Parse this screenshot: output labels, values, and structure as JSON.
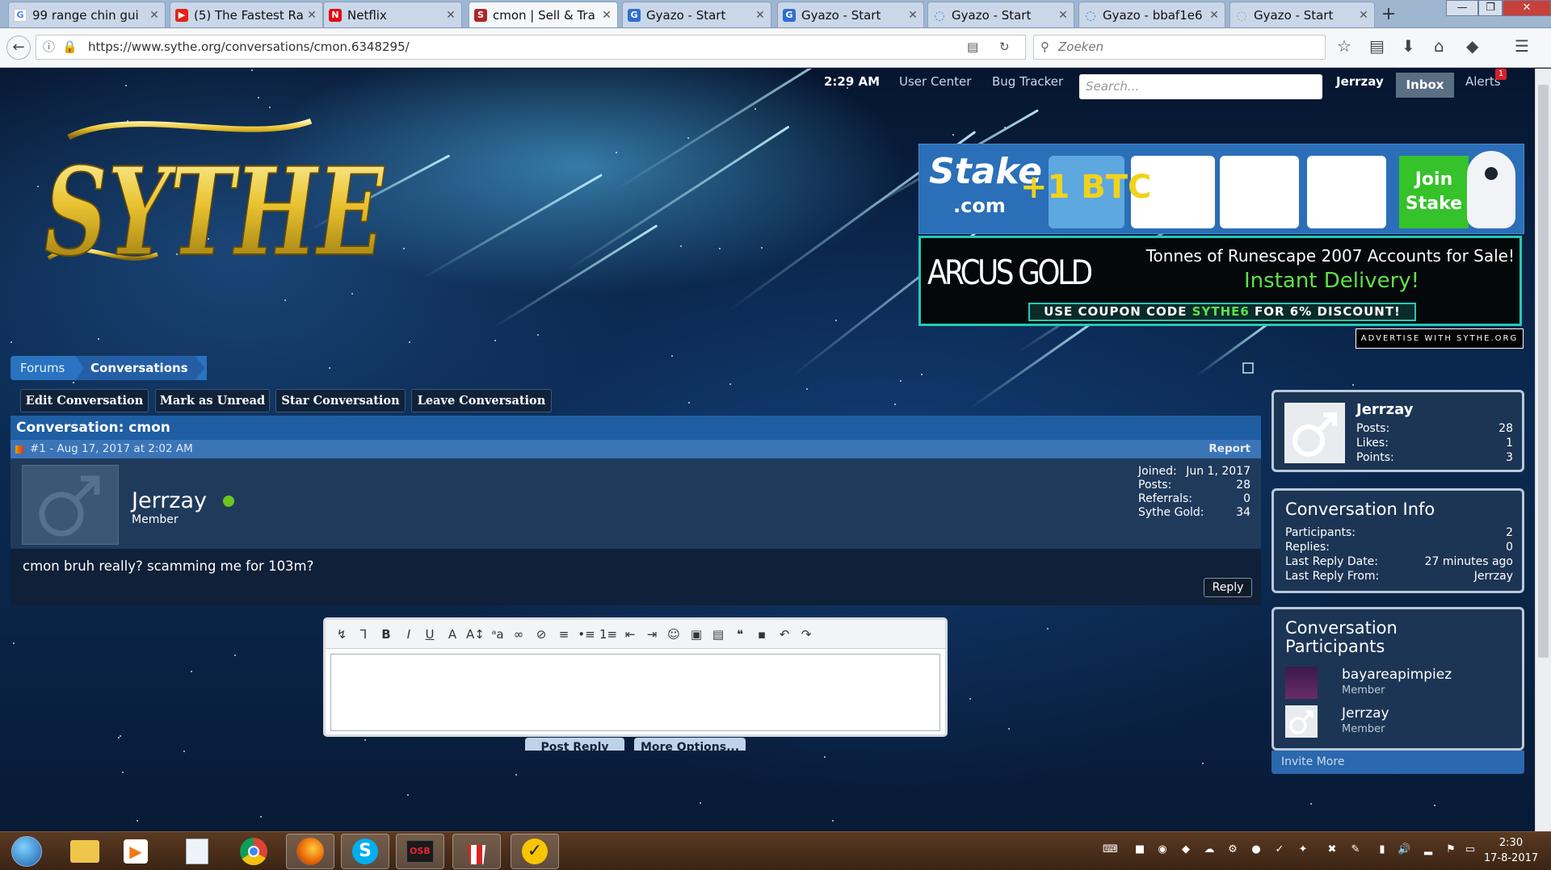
{
  "browser": {
    "tabs": [
      {
        "label": "99 range chin gui",
        "icon": "google-icon",
        "color": "#ffffff"
      },
      {
        "label": "(5) The Fastest Ra",
        "icon": "youtube-icon",
        "color": "#e62117"
      },
      {
        "label": "Netflix",
        "icon": "netflix-icon",
        "color": "#e50914"
      },
      {
        "label": "cmon | Sell & Tra",
        "icon": "sythe-icon",
        "color": "#b0252a"
      },
      {
        "label": "Gyazo - Start",
        "icon": "gyazo-icon",
        "color": "#2f6fd0"
      },
      {
        "label": "Gyazo - Start",
        "icon": "gyazo-icon",
        "color": "#2f6fd0"
      },
      {
        "label": "Gyazo - Start",
        "icon": "loading-icon",
        "color": "#2f86d8"
      },
      {
        "label": "Gyazo - bbaf1e6",
        "icon": "loading-icon",
        "color": "#2f86d8"
      },
      {
        "label": "Gyazo - Start",
        "icon": "loading-icon",
        "color": "#9aa3ad"
      }
    ],
    "url": "https://www.sythe.org/conversations/cmon.6348295/",
    "search_placeholder": "Zoeken"
  },
  "header": {
    "time": "2:29 AM",
    "links": [
      "User Center",
      "Bug Tracker"
    ],
    "search_placeholder": "Search...",
    "username": "Jerrzay",
    "inbox": "Inbox",
    "alerts": "Alerts",
    "alerts_count": "1"
  },
  "ads": {
    "stake_brand": "Stake",
    "stake_domain": ".com",
    "stake_bonus": "+1 BTC",
    "stake_cta": "Join Stake",
    "arcus_brand": "ARCUS GOLD",
    "arcus_line1": "Tonnes of Runescape 2007 Accounts for Sale!",
    "arcus_line2": "Instant Delivery!",
    "coupon_prefix": "USE COUPON CODE ",
    "coupon_code": "SYTHE6",
    "coupon_suffix": " FOR 6% DISCOUNT!",
    "advertise": "ADVERTISE WITH SYTHE.ORG"
  },
  "logo_text": "SYTHE",
  "breadcrumb": [
    "Forums",
    "Conversations"
  ],
  "actions": [
    "Edit Conversation",
    "Mark as Unread",
    "Star Conversation",
    "Leave Conversation"
  ],
  "conversation": {
    "title": "Conversation: cmon",
    "meta": "#1 - Aug 17, 2017 at 2:02 AM",
    "report": "Report",
    "author": "Jerrzay",
    "role": "Member",
    "stats": [
      {
        "label": "Joined:",
        "value": "Jun 1, 2017"
      },
      {
        "label": "Posts:",
        "value": "28"
      },
      {
        "label": "Referrals:",
        "value": "0"
      },
      {
        "label": "Sythe Gold:",
        "value": "34"
      }
    ],
    "message": "cmon bruh really? scamming me for 103m?",
    "reply": "Reply"
  },
  "editor": {
    "tools": [
      "remove-format-icon",
      "clear-icon",
      "bold-icon",
      "italic-icon",
      "underline-icon",
      "font-color-icon",
      "font-size-icon",
      "font-family-icon",
      "link-icon",
      "unlink-icon",
      "align-icon",
      "bullet-list-icon",
      "number-list-icon",
      "outdent-icon",
      "indent-icon",
      "smiley-icon",
      "image-icon",
      "media-icon",
      "quote-icon",
      "save-icon",
      "undo-icon",
      "redo-icon"
    ],
    "post_reply": "Post Reply",
    "more_options": "More Options..."
  },
  "sidebar": {
    "user": {
      "name": "Jerrzay",
      "rows": [
        {
          "label": "Posts:",
          "value": "28"
        },
        {
          "label": "Likes:",
          "value": "1"
        },
        {
          "label": "Points:",
          "value": "3"
        }
      ]
    },
    "info": {
      "title": "Conversation Info",
      "rows": [
        {
          "label": "Participants:",
          "value": "2"
        },
        {
          "label": "Replies:",
          "value": "0"
        },
        {
          "label": "Last Reply Date:",
          "value": "27 minutes ago"
        },
        {
          "label": "Last Reply From:",
          "value": "Jerrzay"
        }
      ]
    },
    "participants": {
      "title_line1": "Conversation",
      "title_line2": "Participants",
      "people": [
        {
          "name": "bayareapimpiez",
          "role": "Member"
        },
        {
          "name": "Jerrzay",
          "role": "Member"
        }
      ],
      "invite": "Invite More"
    }
  },
  "taskbar": {
    "apps": [
      "start-button",
      "explorer-icon",
      "media-player-icon",
      "notepad-icon",
      "chrome-icon",
      "firefox-icon",
      "skype-icon",
      "osbuddy-icon",
      "popcorn-icon",
      "norton-icon"
    ],
    "osb_label": "OSB",
    "time": "2:30",
    "date": "17-8-2017"
  },
  "colors": {
    "accent": "#2a73c0",
    "panel": "#203a5c",
    "online": "#6fc41e"
  }
}
